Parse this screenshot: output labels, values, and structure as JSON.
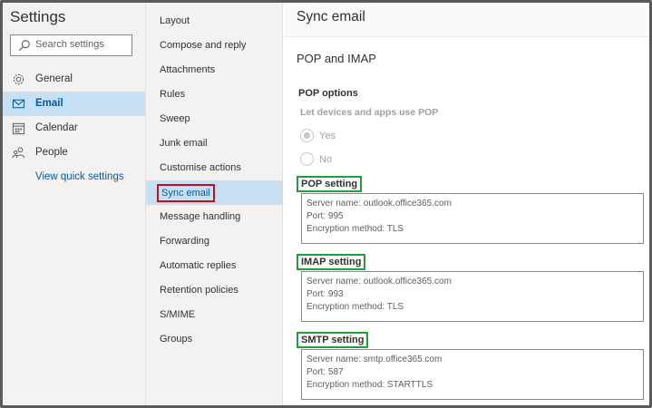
{
  "app": {
    "title": "Settings"
  },
  "search": {
    "placeholder": "Search settings"
  },
  "nav": {
    "items": [
      {
        "label": "General",
        "icon": "gear-icon"
      },
      {
        "label": "Email",
        "icon": "mail-icon",
        "selected": true
      },
      {
        "label": "Calendar",
        "icon": "calendar-icon"
      },
      {
        "label": "People",
        "icon": "people-icon"
      }
    ],
    "quick_settings_link": "View quick settings"
  },
  "subnav": {
    "items": [
      "Layout",
      "Compose and reply",
      "Attachments",
      "Rules",
      "Sweep",
      "Junk email",
      "Customise actions",
      "Sync email",
      "Message handling",
      "Forwarding",
      "Automatic replies",
      "Retention policies",
      "S/MIME",
      "Groups"
    ],
    "selected": "Sync email"
  },
  "main": {
    "title": "Sync email",
    "section_title": "POP and IMAP",
    "pop_options_label": "POP options",
    "let_devices_label": "Let devices and apps use POP",
    "radio_yes": "Yes",
    "radio_no": "No",
    "pop": {
      "label": "POP setting",
      "server": "Server name: outlook.office365.com",
      "port": "Port: 995",
      "encryption": "Encryption method: TLS"
    },
    "imap": {
      "label": "IMAP setting",
      "server": "Server name: outlook.office365.com",
      "port": "Port: 993",
      "encryption": "Encryption method: TLS"
    },
    "smtp": {
      "label": "SMTP setting",
      "server": "Server name: smtp.office365.com",
      "port": "Port: 587",
      "encryption": "Encryption method: STARTTLS"
    }
  },
  "colors": {
    "accent": "#005a9e",
    "selected_bg": "#c7e0f4",
    "highlight_red": "#c50f1f",
    "highlight_green": "#1f9e3a"
  }
}
